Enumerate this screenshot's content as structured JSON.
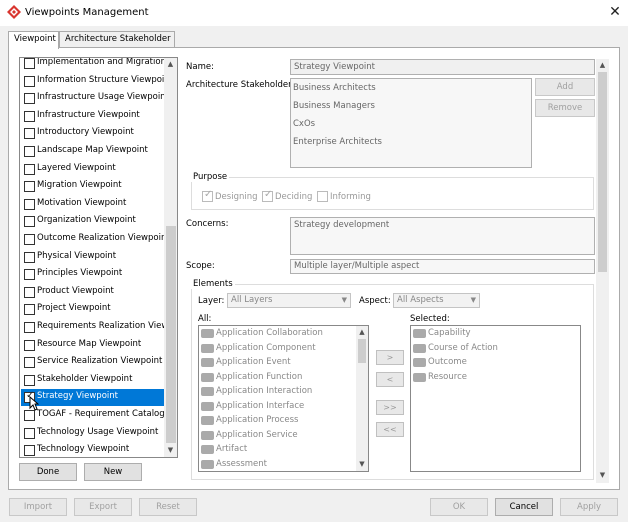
{
  "window": {
    "title": "Viewpoints Management",
    "close_glyph": "✕"
  },
  "tabs": [
    {
      "label": "Viewpoint",
      "selected": true
    },
    {
      "label": "Architecture Stakeholder",
      "selected": false
    }
  ],
  "viewpoint_list": {
    "items": [
      {
        "label": "Implementation and Migration ...",
        "checked": false
      },
      {
        "label": "Information Structure Viewpoint",
        "checked": false
      },
      {
        "label": "Infrastructure Usage Viewpoint",
        "checked": false
      },
      {
        "label": "Infrastructure Viewpoint",
        "checked": false
      },
      {
        "label": "Introductory Viewpoint",
        "checked": false
      },
      {
        "label": "Landscape Map Viewpoint",
        "checked": false
      },
      {
        "label": "Layered Viewpoint",
        "checked": false
      },
      {
        "label": "Migration Viewpoint",
        "checked": false
      },
      {
        "label": "Motivation Viewpoint",
        "checked": false
      },
      {
        "label": "Organization Viewpoint",
        "checked": false
      },
      {
        "label": "Outcome Realization Viewpoint",
        "checked": false
      },
      {
        "label": "Physical Viewpoint",
        "checked": false
      },
      {
        "label": "Principles Viewpoint",
        "checked": false
      },
      {
        "label": "Product Viewpoint",
        "checked": false
      },
      {
        "label": "Project Viewpoint",
        "checked": false
      },
      {
        "label": "Requirements Realization View...",
        "checked": false
      },
      {
        "label": "Resource Map Viewpoint",
        "checked": false
      },
      {
        "label": "Service Realization Viewpoint",
        "checked": false
      },
      {
        "label": "Stakeholder Viewpoint",
        "checked": false
      },
      {
        "label": "Strategy Viewpoint",
        "checked": true,
        "selected": true
      },
      {
        "label": "TOGAF - Requirement Catalog",
        "checked": false
      },
      {
        "label": "Technology Usage Viewpoint",
        "checked": false
      },
      {
        "label": "Technology Viewpoint",
        "checked": false
      }
    ],
    "done_label": "Done",
    "new_label": "New"
  },
  "details": {
    "name_label": "Name:",
    "name_value": "Strategy Viewpoint",
    "stakeholders_label": "Architecture Stakeholders:",
    "stakeholders": [
      "Business Architects",
      "Business Managers",
      "CxOs",
      "Enterprise Architects"
    ],
    "add_label": "Add",
    "remove_label": "Remove",
    "purpose_title": "Purpose",
    "purpose": [
      {
        "label": "Designing",
        "checked": true
      },
      {
        "label": "Deciding",
        "checked": true
      },
      {
        "label": "Informing",
        "checked": false
      }
    ],
    "concerns_label": "Concerns:",
    "concerns_value": "Strategy development",
    "scope_label": "Scope:",
    "scope_value": "Multiple layer/Multiple aspect",
    "elements_title": "Elements",
    "layer_label": "Layer:",
    "layer_value": "All Layers",
    "aspect_label": "Aspect:",
    "aspect_value": "All Aspects",
    "all_label": "All:",
    "selected_label": "Selected:",
    "all_elements": [
      "Application Collaboration",
      "Application Component",
      "Application Event",
      "Application Function",
      "Application Interaction",
      "Application Interface",
      "Application Process",
      "Application Service",
      "Artifact",
      "Assessment"
    ],
    "selected_elements": [
      "Capability",
      "Course of Action",
      "Outcome",
      "Resource"
    ],
    "move_buttons": [
      ">",
      "<",
      ">>",
      "<<"
    ]
  },
  "footer": {
    "import_label": "Import",
    "export_label": "Export",
    "reset_label": "Reset",
    "ok_label": "OK",
    "cancel_label": "Cancel",
    "apply_label": "Apply"
  },
  "colors": {
    "selection": "#0078d7",
    "brand_icon": "#d9352f"
  }
}
